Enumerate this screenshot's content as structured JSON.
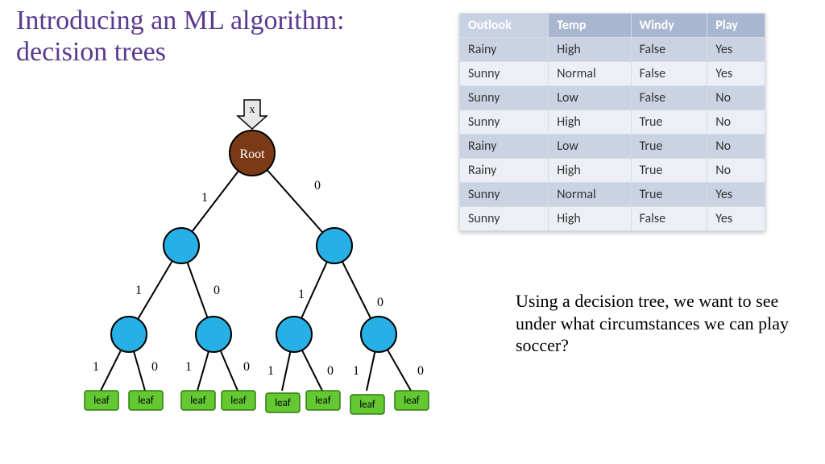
{
  "title_line1": "Introducing an ML algorithm:",
  "title_line2": "decision trees",
  "caption": "Using a decision tree, we want to see under what circumstances we can play soccer?",
  "table": {
    "headers": [
      "Outlook",
      "Temp",
      "Windy",
      "Play"
    ],
    "rows": [
      [
        "Rainy",
        "High",
        "False",
        "Yes"
      ],
      [
        "Sunny",
        "Normal",
        "False",
        "Yes"
      ],
      [
        "Sunny",
        "Low",
        "False",
        "No"
      ],
      [
        "Sunny",
        "High",
        "True",
        "No"
      ],
      [
        "Rainy",
        "Low",
        "True",
        "No"
      ],
      [
        "Rainy",
        "High",
        "True",
        "No"
      ],
      [
        "Sunny",
        "Normal",
        "True",
        "Yes"
      ],
      [
        "Sunny",
        "High",
        "False",
        "Yes"
      ]
    ]
  },
  "tree": {
    "input_label": "x",
    "root_label": "Root",
    "edge_labels": {
      "left": "1",
      "right": "0"
    },
    "leaf_label": "leaf"
  }
}
